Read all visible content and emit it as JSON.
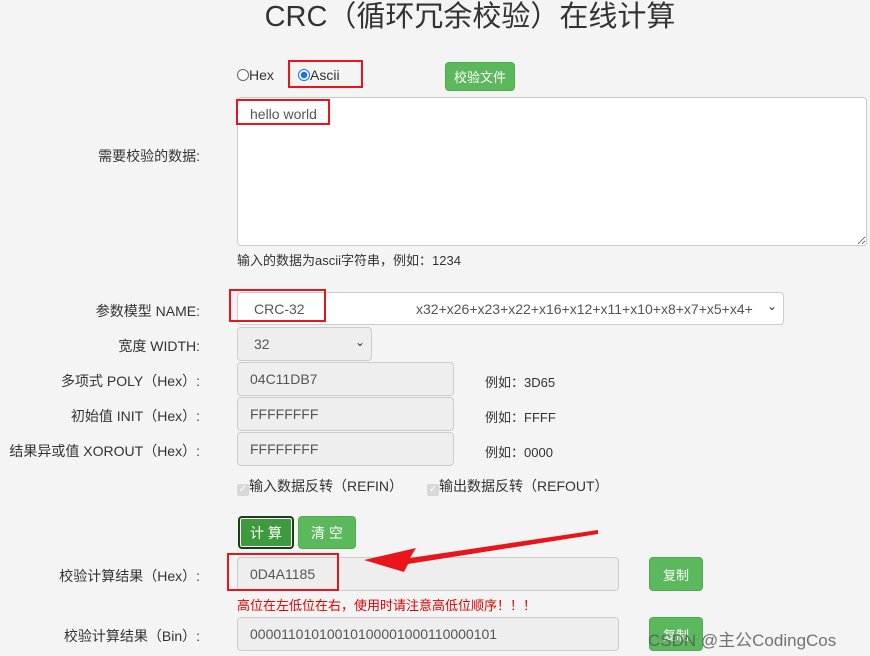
{
  "page": {
    "title": "CRC（循环冗余校验）在线计算"
  },
  "input_mode": {
    "options": [
      {
        "label": "Hex",
        "selected": false
      },
      {
        "label": "Ascii",
        "selected": true
      }
    ],
    "file_button": "校验文件"
  },
  "data_input": {
    "label": "需要校验的数据:",
    "value": "hello world",
    "hint": "输入的数据为ascii字符串，例如：1234"
  },
  "params": {
    "name": {
      "label": "参数模型 NAME:",
      "value": "CRC-32",
      "poly_text": "x32+x26+x23+x22+x16+x12+x11+x10+x8+x7+x5+x4+"
    },
    "width": {
      "label": "宽度 WIDTH:",
      "value": "32"
    },
    "poly": {
      "label": "多项式 POLY（Hex）:",
      "value": "04C11DB7",
      "example": "例如：3D65"
    },
    "init": {
      "label": "初始值 INIT（Hex）:",
      "value": "FFFFFFFF",
      "example": "例如：FFFF"
    },
    "xorout": {
      "label": "结果异或值 XOROUT（Hex）:",
      "value": "FFFFFFFF",
      "example": "例如：0000"
    },
    "refin": {
      "label": "输入数据反转（REFIN）",
      "checked": true
    },
    "refout": {
      "label": "输出数据反转（REFOUT）",
      "checked": true
    }
  },
  "actions": {
    "calculate": "计 算",
    "clear": "清 空"
  },
  "result": {
    "hex": {
      "label": "校验计算结果（Hex）:",
      "value": "0D4A1185",
      "copy": "复制"
    },
    "warning": "高位在左低位在右，使用时请注意高低位顺序！！！",
    "bin": {
      "label": "校验计算结果（Bin）:",
      "value": "00001101010010100001000110000101",
      "copy": "复制"
    }
  },
  "watermark": "CSDN @主公CodingCos",
  "colors": {
    "accent_green": "#5cb85c",
    "annotation_red": "#e8151b",
    "warning_red": "#e00000"
  }
}
